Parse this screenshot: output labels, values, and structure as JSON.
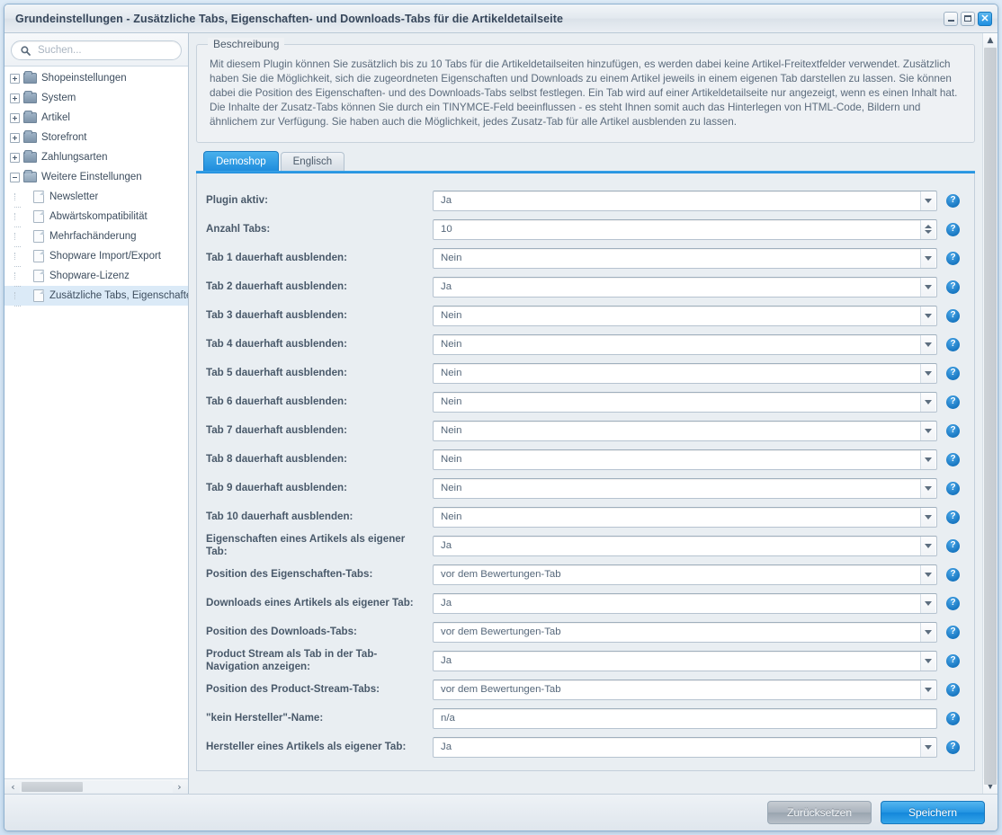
{
  "window": {
    "title": "Grundeinstellungen - Zusätzliche Tabs, Eigenschaften- und Downloads-Tabs für die Artikeldetailseite",
    "minimize_label": "",
    "maximize_label": "",
    "close_label": "✕"
  },
  "sidebar": {
    "search": {
      "placeholder": "Suchen...",
      "value": "",
      "icon": "search-icon"
    },
    "tree": [
      {
        "label": "Shopeinstellungen",
        "type": "folder",
        "expanded": false,
        "selected": false
      },
      {
        "label": "System",
        "type": "folder",
        "expanded": false,
        "selected": false
      },
      {
        "label": "Artikel",
        "type": "folder",
        "expanded": false,
        "selected": false
      },
      {
        "label": "Storefront",
        "type": "folder",
        "expanded": false,
        "selected": false
      },
      {
        "label": "Zahlungsarten",
        "type": "folder",
        "expanded": false,
        "selected": false
      },
      {
        "label": "Weitere Einstellungen",
        "type": "folder",
        "expanded": true,
        "selected": false
      },
      {
        "label": "Newsletter",
        "type": "doc",
        "selected": false
      },
      {
        "label": "Abwärtskompatibilität",
        "type": "doc",
        "selected": false
      },
      {
        "label": "Mehrfachänderung",
        "type": "doc",
        "selected": false
      },
      {
        "label": "Shopware Import/Export",
        "type": "doc",
        "selected": false
      },
      {
        "label": "Shopware-Lizenz",
        "type": "doc",
        "selected": false
      },
      {
        "label": "Zusätzliche Tabs, Eigenschafte",
        "type": "doc",
        "selected": true
      }
    ],
    "hscroll": {
      "left_arrow": "‹",
      "right_arrow": "›"
    }
  },
  "description": {
    "legend": "Beschreibung",
    "text": "Mit diesem Plugin können Sie zusätzlich bis zu 10 Tabs für die Artikeldetailseiten hinzufügen, es werden dabei keine Artikel-Freitextfelder verwendet. Zusätzlich haben Sie die Möglichkeit, sich die zugeordneten Eigenschaften und Downloads zu einem Artikel jeweils in einem eigenen Tab darstellen zu lassen. Sie können dabei die Position des Eigenschaften- und des Downloads-Tabs selbst festlegen. Ein Tab wird auf einer Artikeldetailseite nur angezeigt, wenn es einen Inhalt hat. Die Inhalte der Zusatz-Tabs können Sie durch ein TINYMCE-Feld beeinflussen - es steht Ihnen somit auch das Hinterlegen von HTML-Code, Bildern und ähnlichem zur Verfügung. Sie haben auch die Möglichkeit, jedes Zusatz-Tab für alle Artikel ausblenden zu lassen."
  },
  "tabs": [
    {
      "label": "Demoshop",
      "active": true
    },
    {
      "label": "Englisch",
      "active": false
    }
  ],
  "form": {
    "help_glyph": "?",
    "fields": [
      {
        "label": "Plugin aktiv:",
        "value": "Ja",
        "control": "select"
      },
      {
        "label": "Anzahl Tabs:",
        "value": "10",
        "control": "number"
      },
      {
        "label": "Tab 1 dauerhaft ausblenden:",
        "value": "Nein",
        "control": "select"
      },
      {
        "label": "Tab 2 dauerhaft ausblenden:",
        "value": "Ja",
        "control": "select"
      },
      {
        "label": "Tab 3 dauerhaft ausblenden:",
        "value": "Nein",
        "control": "select"
      },
      {
        "label": "Tab 4 dauerhaft ausblenden:",
        "value": "Nein",
        "control": "select"
      },
      {
        "label": "Tab 5 dauerhaft ausblenden:",
        "value": "Nein",
        "control": "select"
      },
      {
        "label": "Tab 6 dauerhaft ausblenden:",
        "value": "Nein",
        "control": "select"
      },
      {
        "label": "Tab 7 dauerhaft ausblenden:",
        "value": "Nein",
        "control": "select"
      },
      {
        "label": "Tab 8 dauerhaft ausblenden:",
        "value": "Nein",
        "control": "select"
      },
      {
        "label": "Tab 9 dauerhaft ausblenden:",
        "value": "Nein",
        "control": "select"
      },
      {
        "label": "Tab 10 dauerhaft ausblenden:",
        "value": "Nein",
        "control": "select"
      },
      {
        "label": "Eigenschaften eines Artikels als eigener Tab:",
        "value": "Ja",
        "control": "select"
      },
      {
        "label": "Position des Eigenschaften-Tabs:",
        "value": "vor dem Bewertungen-Tab",
        "control": "select"
      },
      {
        "label": "Downloads eines Artikels als eigener Tab:",
        "value": "Ja",
        "control": "select"
      },
      {
        "label": "Position des Downloads-Tabs:",
        "value": "vor dem Bewertungen-Tab",
        "control": "select"
      },
      {
        "label": "Product Stream als Tab in der Tab-Navigation anzeigen:",
        "value": "Ja",
        "control": "select"
      },
      {
        "label": "Position des Product-Stream-Tabs:",
        "value": "vor dem Bewertungen-Tab",
        "control": "select"
      },
      {
        "label": "\"kein Hersteller\"-Name:",
        "value": "n/a",
        "control": "text"
      },
      {
        "label": "Hersteller eines Artikels als eigener Tab:",
        "value": "Ja",
        "control": "select"
      }
    ]
  },
  "footer": {
    "reset_label": "Zurücksetzen",
    "save_label": "Speichern"
  },
  "scrollbar": {
    "up_arrow": "▲",
    "down_arrow": "▼"
  },
  "colors": {
    "accent": "#1f8ddd",
    "tab_active": "#2f9de6",
    "help_blue": "#1574bf",
    "label_text": "#49596a",
    "value_text": "#55677a"
  }
}
